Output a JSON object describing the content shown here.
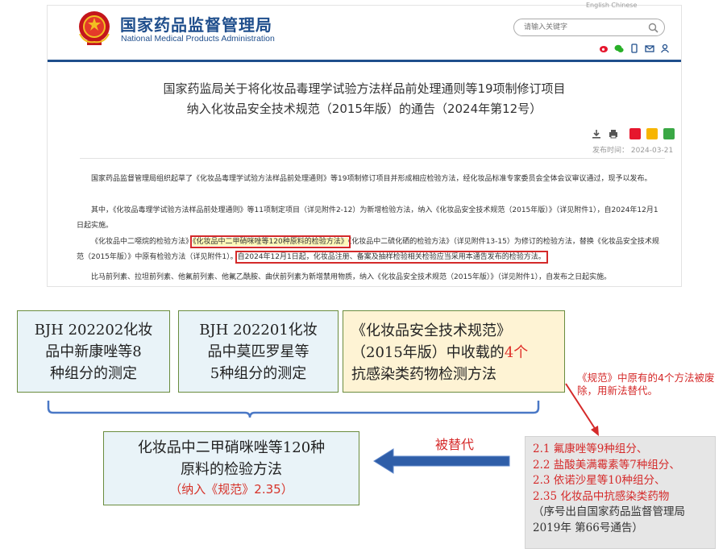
{
  "header": {
    "agency_cn": "国家药品监督管理局",
    "agency_en": "National Medical Products Administration",
    "top_links": "English  Chinese",
    "search_placeholder": "请输入关键字"
  },
  "article": {
    "title_line1": "国家药监局关于将化妆品毒理学试验方法样品前处理通则等19项制修订项目",
    "title_line2": "纳入化妆品安全技术规范（2015年版）的通告（2024年第12号）",
    "publish_date": "发布时间： 2024-03-21",
    "p1": "国家药品监督管理局组织起草了《化妆品毒理学试验方法样品前处理通则》等19项制修订项目并形成相应检验方法，经化妆品标准专家委员会全体会议审议通过，现予以发布。",
    "p2": "其中，《化妆品毒理学试验方法样品前处理通则》等11项制定项目（详见附件2-12）为新增检验方法，纳入《化妆品安全技术规范（2015年版）》（详见附件1），自2024年12月1日起实施。",
    "p3_a": "《化妆品中二噁烷的检验方法》",
    "p3_highlight": "《化妆品中二甲硝咪唑等120种原料的检验方法》",
    "p3_b": "《化妆品中二硫化硒的检验方法》（详见附件13-15）为修订的检验方法，替换《化妆品安全技术规范（2015年版）》中原有检验方法（详见附件1）。",
    "p3_redbox": "自2024年12月1日起，化妆品注册、备案及抽样检验相关检验应当采用本通告发布的检验方法。",
    "p4": "比马前列素、拉坦前列素、他氟前列素、他氟乙酰胺、曲伏前列素为新增禁用物质，纳入《化妆品安全技术规范（2015年版）》（详见附件1），自发布之日起实施。"
  },
  "diagram": {
    "box1": [
      "BJH 202202化妆",
      "品中新康唑等8",
      "种组分的测定"
    ],
    "box2": [
      "BJH 202201化妆",
      "品中莫匹罗星等",
      "5种组分的测定"
    ],
    "box3_line1": "《化妆品安全技术规范》",
    "box3_line2a": "（2015年版）中收载的",
    "box3_line2b": "4个",
    "box3_line3": "抗感染类药物检测方法",
    "main_line1": "化妆品中二甲硝咪唑等120种",
    "main_line2": "原料的检验方法",
    "main_line3": "（纳入《规范》2.35）",
    "replaced_label": "被替代",
    "note": "《规范》中原有的4个方法被废除，用新法替代。",
    "gray_items": [
      "2.1 氟康唑等9种组分、",
      "2.2 盐酸美满霉素等7种组分、",
      "2.3 依诺沙星等10种组分、",
      "2.35 化妆品中抗感染类药物"
    ],
    "gray_note": "（序号出自国家药品监督管理局2019年 第66号通告）"
  },
  "colors": {
    "brand_blue": "#1f4e8c",
    "accent_red": "#d52a2a",
    "arrow_blue": "#2f5ea8",
    "box_border_green": "#6a8c3e"
  },
  "icons": [
    "emblem-icon",
    "search-icon",
    "weibo-icon",
    "wechat-icon",
    "mobile-icon",
    "mail-icon",
    "user-icon",
    "download-icon",
    "print-icon"
  ]
}
